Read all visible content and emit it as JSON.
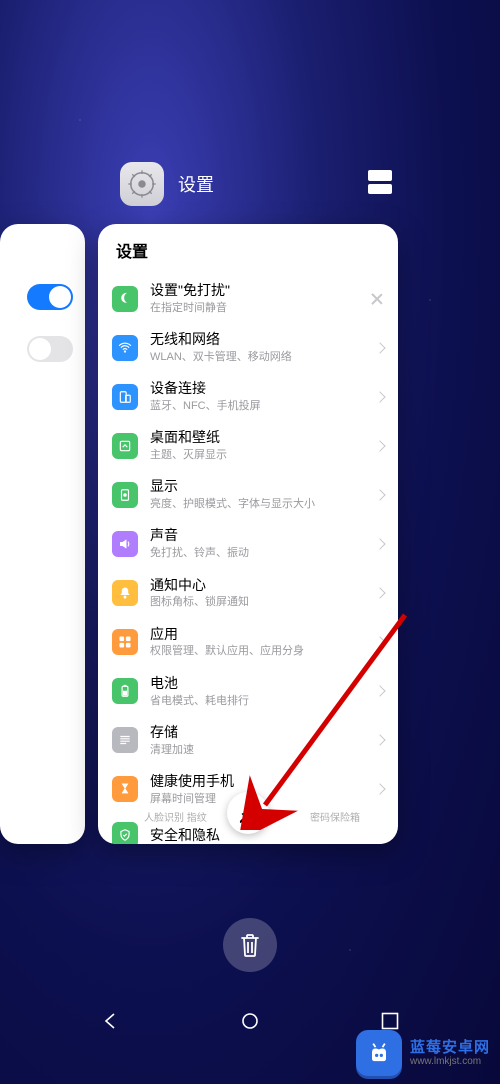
{
  "recents": {
    "app_name": "设置",
    "card_title": "设置"
  },
  "left_toggles": [
    {
      "state": "on"
    },
    {
      "state": "off"
    }
  ],
  "rows": [
    {
      "icon": "moon",
      "icon_bg": "#48c46b",
      "title": "设置\"免打扰\"",
      "sub": "在指定时间静音",
      "tail": "close"
    },
    {
      "icon": "wifi",
      "icon_bg": "#2c93ff",
      "title": "无线和网络",
      "sub": "WLAN、双卡管理、移动网络",
      "tail": "chev"
    },
    {
      "icon": "device",
      "icon_bg": "#2c93ff",
      "title": "设备连接",
      "sub": "蓝牙、NFC、手机投屏",
      "tail": "chev"
    },
    {
      "icon": "home",
      "icon_bg": "#48c46b",
      "title": "桌面和壁纸",
      "sub": "主题、灭屏显示",
      "tail": "chev"
    },
    {
      "icon": "display",
      "icon_bg": "#48c46b",
      "title": "显示",
      "sub": "亮度、护眼模式、字体与显示大小",
      "tail": "chev"
    },
    {
      "icon": "sound",
      "icon_bg": "#b07dff",
      "title": "声音",
      "sub": "免打扰、铃声、振动",
      "tail": "chev"
    },
    {
      "icon": "bell",
      "icon_bg": "#ffbe3d",
      "title": "通知中心",
      "sub": "图标角标、锁屏通知",
      "tail": "chev"
    },
    {
      "icon": "apps",
      "icon_bg": "#ff9a3d",
      "title": "应用",
      "sub": "权限管理、默认应用、应用分身",
      "tail": "chev"
    },
    {
      "icon": "battery",
      "icon_bg": "#48c46b",
      "title": "电池",
      "sub": "省电模式、耗电排行",
      "tail": "chev"
    },
    {
      "icon": "storage",
      "icon_bg": "#b8b8bf",
      "title": "存储",
      "sub": "清理加速",
      "tail": "chev"
    },
    {
      "icon": "hourglass",
      "icon_bg": "#ff9a3d",
      "title": "健康使用手机",
      "sub": "屏幕时间管理",
      "tail": "chev"
    },
    {
      "icon": "shield",
      "icon_bg": "#48c46b",
      "title": "安全和隐私",
      "sub_left": "人脸识别  指纹",
      "sub_right": "密码保险箱",
      "tail": "none"
    }
  ],
  "watermark": {
    "line1": "蓝莓安卓网",
    "line2": "www.lmkjst.com"
  }
}
